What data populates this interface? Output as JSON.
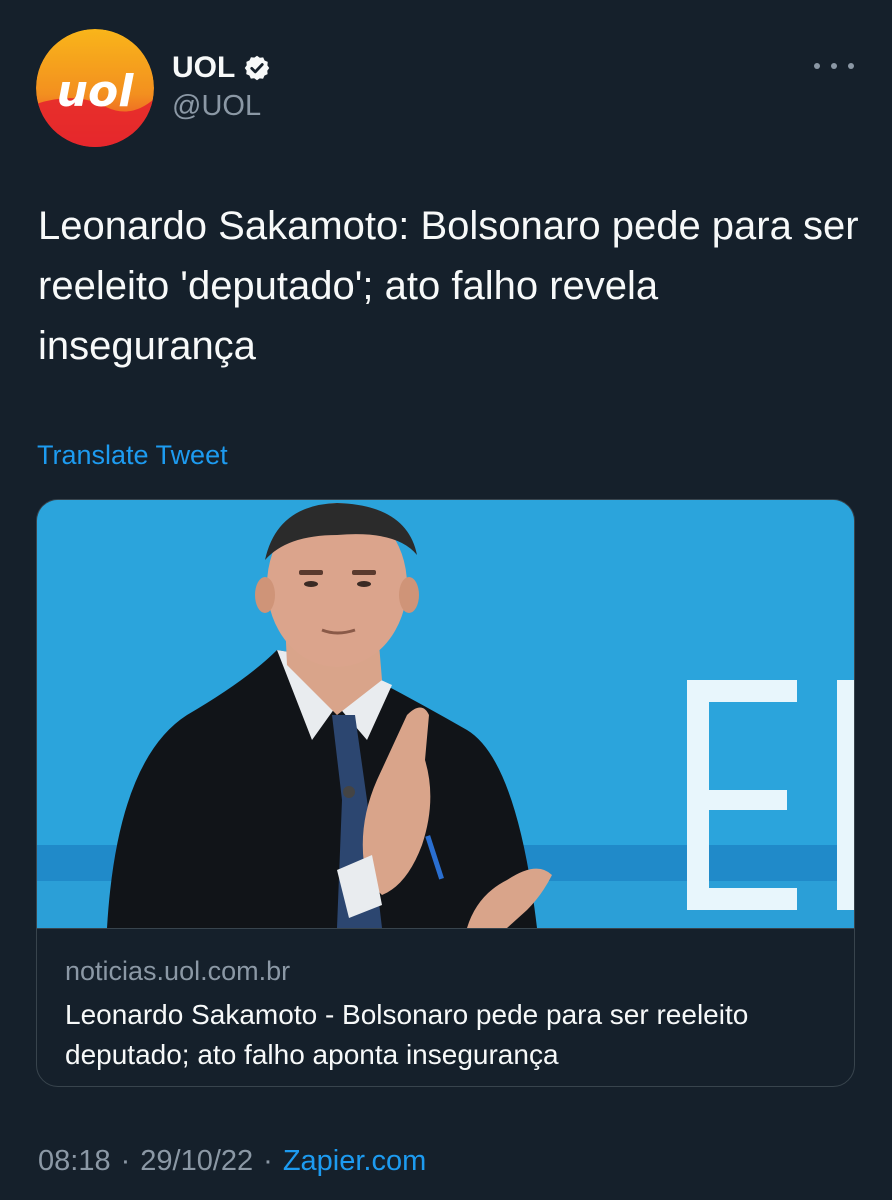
{
  "author": {
    "avatar_text": "uol",
    "display_name": "UOL",
    "handle": "@UOL",
    "verified": true
  },
  "icons": {
    "more": "more-options-icon",
    "verified": "verified-badge-icon"
  },
  "tweet": {
    "text": "Leonardo Sakamoto: Bolsonaro pede para ser reeleito 'deputado'; ato falho revela insegurança",
    "translate_label": "Translate Tweet"
  },
  "card": {
    "domain": "noticias.uol.com.br",
    "title": "Leonardo Sakamoto - Bolsonaro pede para ser reeleito deputado; ato falho aponta insegurança"
  },
  "footer": {
    "time": "08:18",
    "separator1": "·",
    "date": "29/10/22",
    "separator2": "·",
    "source": "Zapier.com"
  },
  "colors": {
    "background": "#15202b",
    "text": "#f7f9f9",
    "secondary": "#8b98a5",
    "link": "#1d9bf0",
    "border": "#38444d",
    "brand_orange": "#f7a21b",
    "brand_red": "#e5262c"
  }
}
